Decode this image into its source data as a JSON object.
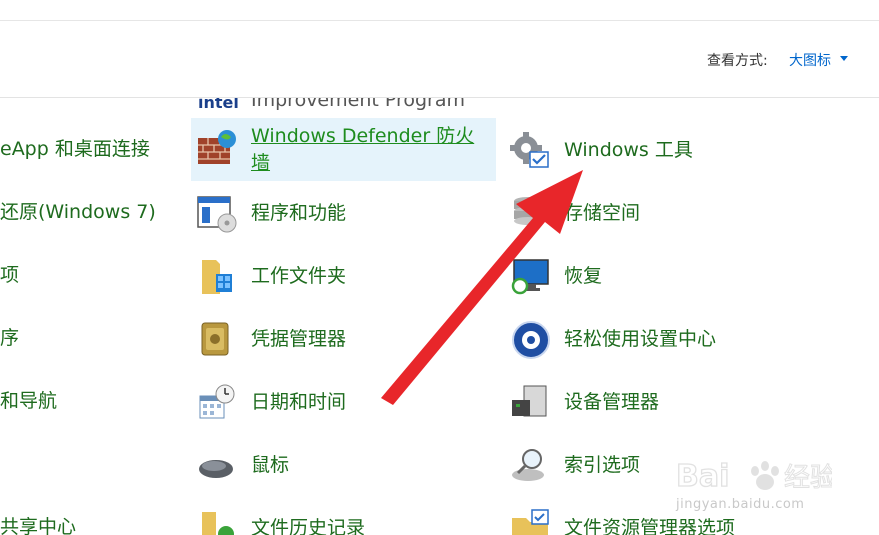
{
  "view": {
    "label": "查看方式:",
    "value": "大图标"
  },
  "left_column": [
    "eApp 和桌面连接",
    "还原(Windows 7)",
    "项",
    "序",
    "和导航",
    "共享中心"
  ],
  "middle_column": {
    "partial_top": "Improvement Program",
    "defender_line1": "Windows Defender 防火",
    "defender_line2": "墙",
    "items": [
      "程序和功能",
      "工作文件夹",
      "凭据管理器",
      "日期和时间",
      "鼠标",
      "文件历史记录"
    ]
  },
  "right_column": {
    "items": [
      "Windows 工具",
      "存储空间",
      "恢复",
      "轻松使用设置中心",
      "设备管理器",
      "索引选项",
      "文件资源管理器选项"
    ]
  },
  "icons": {
    "intel": "intel-logo-icon",
    "firewall": "firewall-icon",
    "programs": "programs-icon",
    "work_folders": "work-folders-icon",
    "credential": "credential-manager-icon",
    "datetime": "date-time-icon",
    "mouse": "mouse-icon",
    "file_history": "file-history-icon",
    "tools": "windows-tools-icon",
    "storage": "storage-spaces-icon",
    "recovery": "recovery-icon",
    "ease": "ease-of-access-icon",
    "device": "device-manager-icon",
    "index": "indexing-options-icon",
    "explorer": "explorer-options-icon"
  },
  "watermark": {
    "brand": "Bai",
    "brand2": "经验",
    "url": "jingyan.baidu.com"
  },
  "colors": {
    "link": "#1e6b1e",
    "accent": "#0066cc",
    "highlight": "#e5f3fb",
    "arrow": "#e8262a"
  }
}
